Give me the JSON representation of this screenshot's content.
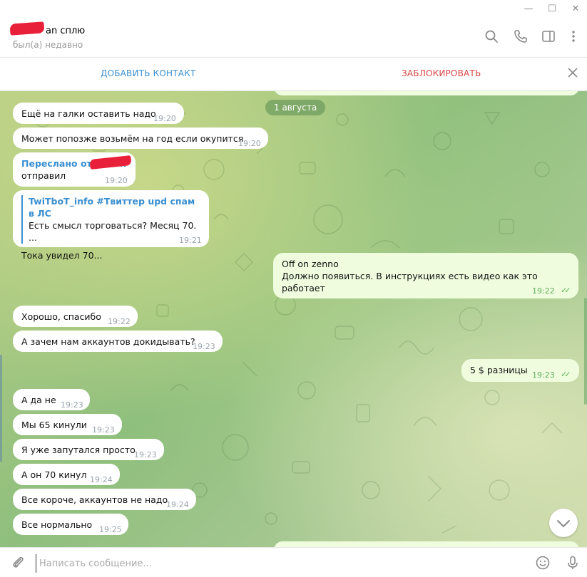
{
  "window": {
    "minimize": "—",
    "maximize": "☐",
    "close": "✕"
  },
  "header": {
    "name": "an сплю",
    "status": "был(а) недавно",
    "icons": [
      "search-icon",
      "phone-icon",
      "sidebar-icon",
      "more-icon"
    ]
  },
  "actions": {
    "add_contact": "ДОБАВИТЬ КОНТАКТ",
    "block": "ЗАБЛОКИРОВАТЬ"
  },
  "date_separator": "1 августа",
  "messages": [
    {
      "text": "Ещё на галки оставить надо",
      "time": "19:20"
    },
    {
      "text": "Может попозже возьмём на год если окупится",
      "time": "19:20"
    },
    {
      "forwarded_from": "Переслано от р",
      "forwarded_tail": "к",
      "text": "отправил",
      "time": "19:20"
    },
    {
      "quote_title": "TwiTboT_info #Твиттер upd спам в ЛС",
      "quote_text": "Есть смысл торговаться?  Месяц 70. ...",
      "text": "Тока увидел 70...",
      "time": "19:21"
    },
    {
      "line1": "Off on zenno",
      "line2": "Должно появиться. В инструкциях есть видео как это работает",
      "time": "19:22",
      "out": true
    },
    {
      "text": "Хорошо, спасибо",
      "time": "19:22"
    },
    {
      "text": "А зачем нам аккаунтов докидывать?",
      "time": "19:23"
    },
    {
      "text": "5 $ разницы",
      "time": "19:23",
      "out": true
    },
    {
      "text": "А да не",
      "time": "19:23"
    },
    {
      "text": "Мы 65 кинули",
      "time": "19:23"
    },
    {
      "text": "Я уже запутался просто",
      "time": "19:23"
    },
    {
      "text": "А он 70 кинул",
      "time": "19:24"
    },
    {
      "text": "Все короче, аккаунтов не надо",
      "time": "19:24"
    },
    {
      "text": "Все нормально",
      "time": "19:25"
    }
  ],
  "composer": {
    "placeholder": "Написать сообщение..."
  },
  "colors": {
    "accent": "#3a8fd0",
    "danger": "#d84444",
    "outgoing": "#effdde",
    "check": "#5bb35b"
  }
}
